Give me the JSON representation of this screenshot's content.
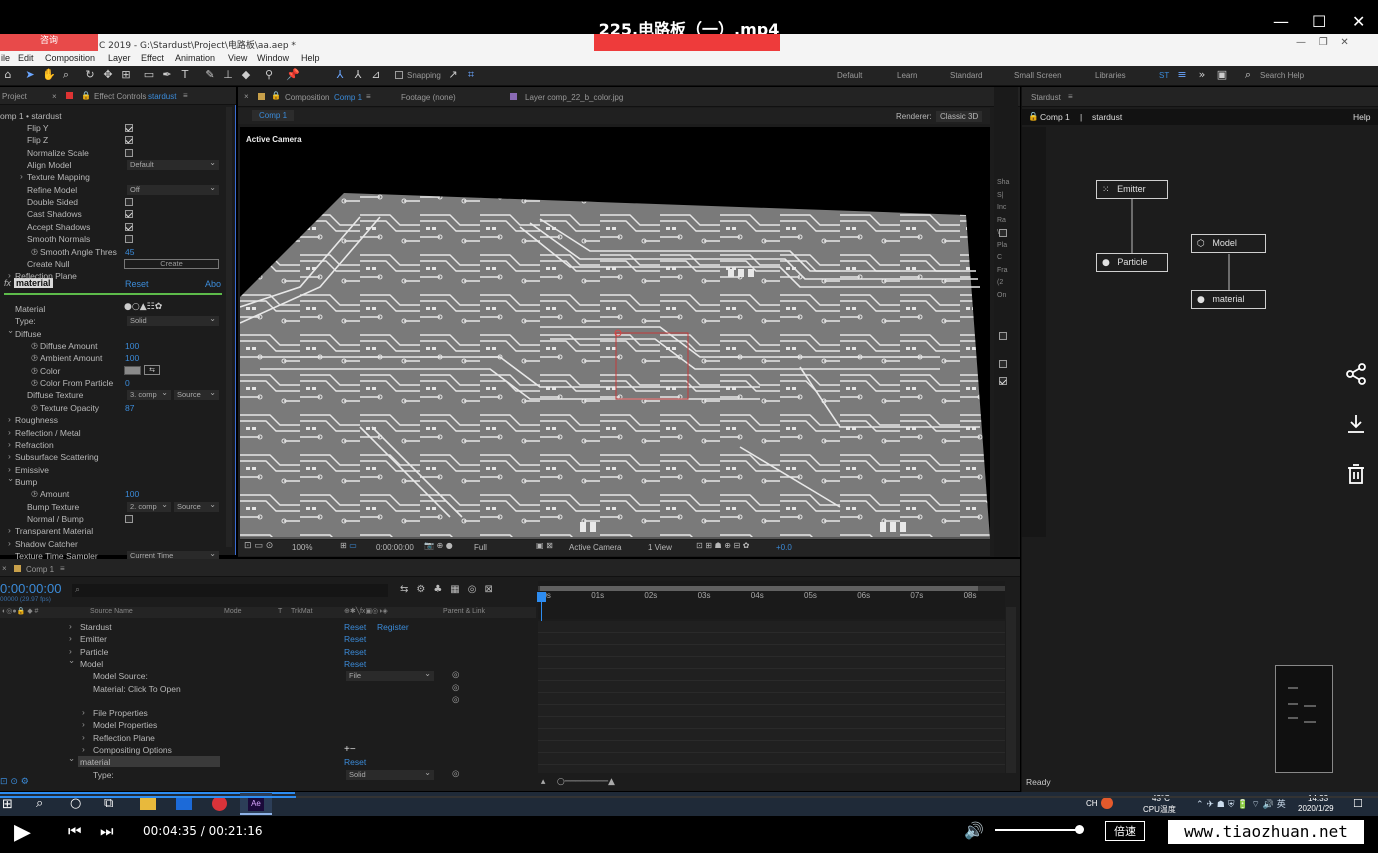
{
  "video_title": "225.电路板（一）.mp4",
  "window_buttons": {
    "minimize": "—",
    "maximize": "☐",
    "close": "✕"
  },
  "ask_button": "咨询",
  "ae_title": "C 2019 - G:\\Stardust\\Project\\电路板\\aa.aep *",
  "menu": [
    "ile",
    "Edit",
    "Composition",
    "Layer",
    "Effect",
    "Animation",
    "View",
    "Window",
    "Help"
  ],
  "toolbar": {
    "snapping": "Snapping"
  },
  "workspaces": [
    "Default",
    "Learn",
    "Standard",
    "Small Screen",
    "Libraries",
    "ST"
  ],
  "search_help": "Search Help",
  "project_tab": "Project",
  "effect_controls_tab": "Effect Controls",
  "effect_controls_layer": "stardust",
  "ec_breadcrumb": "omp 1 • stardust",
  "effect_rows": [
    {
      "label": "Flip Y",
      "indent": 27,
      "check": true
    },
    {
      "label": "Flip Z",
      "indent": 27,
      "check": true
    },
    {
      "label": "Normalize Scale",
      "indent": 27,
      "check": false
    },
    {
      "label": "Align Model",
      "indent": 27,
      "dropdown": "Default"
    },
    {
      "label": "Texture Mapping",
      "indent": 27,
      "arrow": true
    },
    {
      "label": "Refine Model",
      "indent": 27,
      "dropdown": "Off"
    },
    {
      "label": "Double Sided",
      "indent": 27,
      "check": false
    },
    {
      "label": "Cast Shadows",
      "indent": 27,
      "check": true
    },
    {
      "label": "Accept Shadows",
      "indent": 27,
      "check": true
    },
    {
      "label": "Smooth Normals",
      "indent": 27,
      "check": false
    },
    {
      "label": "Smooth Angle Thres",
      "indent": 40,
      "value": "45",
      "stopwatch": true,
      "arrow": true
    },
    {
      "label": "Create Null",
      "indent": 27,
      "button": "Create"
    },
    {
      "label": "Reflection Plane",
      "indent": 15,
      "arrow": true
    }
  ],
  "material_header": {
    "name": "material",
    "reset": "Reset",
    "about": "Abo"
  },
  "material_rows": [
    {
      "label": "Material",
      "indent": 15
    },
    {
      "label": "Type:",
      "indent": 15,
      "dropdown": "Solid"
    },
    {
      "label": "Diffuse",
      "indent": 15,
      "open": true
    },
    {
      "label": "Diffuse Amount",
      "indent": 40,
      "value": "100",
      "stopwatch": true,
      "arrow": true
    },
    {
      "label": "Ambient Amount",
      "indent": 40,
      "value": "100",
      "stopwatch": true,
      "arrow": true
    },
    {
      "label": "Color",
      "indent": 40,
      "stopwatch": true,
      "arrow": true,
      "swatch": true
    },
    {
      "label": "Color From Particle",
      "indent": 40,
      "value": "0",
      "stopwatch": true,
      "arrow": true
    },
    {
      "label": "Diffuse Texture",
      "indent": 27,
      "dropdown": "3. comp",
      "dropdown2": "Source"
    },
    {
      "label": "Texture Opacity",
      "indent": 40,
      "value": "87",
      "stopwatch": true,
      "arrow": true
    },
    {
      "label": "Roughness",
      "indent": 15,
      "arrow": true
    },
    {
      "label": "Reflection / Metal",
      "indent": 15,
      "arrow": true
    },
    {
      "label": "Refraction",
      "indent": 15,
      "arrow": true
    },
    {
      "label": "Subsurface Scattering",
      "indent": 15,
      "arrow": true
    },
    {
      "label": "Emissive",
      "indent": 15,
      "arrow": true
    },
    {
      "label": "Bump",
      "indent": 15,
      "open": true
    },
    {
      "label": "Amount",
      "indent": 40,
      "value": "100",
      "stopwatch": true,
      "arrow": true
    },
    {
      "label": "Bump Texture",
      "indent": 27,
      "dropdown": "2. comp",
      "dropdown2": "Source"
    },
    {
      "label": "Normal / Bump",
      "indent": 27,
      "check": false
    },
    {
      "label": "Transparent Material",
      "indent": 15,
      "arrow": true
    },
    {
      "label": "Shadow Catcher",
      "indent": 15,
      "arrow": true
    },
    {
      "label": "Texture Time Sampler",
      "indent": 15,
      "dropdown": "Current Time"
    }
  ],
  "comp_tabs": [
    "Composition",
    "Footage (none)",
    "Layer comp_22_b_color.jpg"
  ],
  "comp_tab_name": "Comp 1",
  "comp_subtab": "Comp 1",
  "renderer_label": "Renderer:",
  "renderer_value": "Classic 3D",
  "active_camera_label": "Active Camera",
  "viewer_footer": {
    "zoom": "100%",
    "timecode": "0:00:00:00",
    "resolution": "Full",
    "camera": "Active Camera",
    "views": "1 View",
    "exposure": "+0.0"
  },
  "side_strip": [
    "Sha",
    "S|",
    "Inc",
    "Ra",
    "W",
    "Pla",
    "C",
    "Fra",
    "(2",
    "On"
  ],
  "stardust_panel": {
    "title": "Stardust",
    "comp": "Comp 1",
    "layer": "stardust",
    "help": "Help",
    "nodes": [
      "Emitter",
      "Particle",
      "Model",
      "material"
    ],
    "status": "Ready"
  },
  "timeline": {
    "tab": "Comp 1",
    "timecode": "0:00:00:00",
    "fps": "00000 (29.97 fps)",
    "columns": [
      "Source Name",
      "Mode",
      "T",
      "TrkMat",
      "Parent & Link"
    ],
    "ruler": [
      "00s",
      "01s",
      "02s",
      "03s",
      "04s",
      "05s",
      "06s",
      "07s",
      "08s"
    ]
  },
  "timeline_rows": [
    {
      "label": "Stardust",
      "indent": 80,
      "arrow": true,
      "reset": "Reset",
      "extra": "Register"
    },
    {
      "label": "Emitter",
      "indent": 80,
      "arrow": true,
      "reset": "Reset"
    },
    {
      "label": "Particle",
      "indent": 80,
      "arrow": true,
      "reset": "Reset"
    },
    {
      "label": "Model",
      "indent": 80,
      "open": true,
      "reset": "Reset"
    },
    {
      "label": "Model Source:",
      "indent": 93,
      "dropdown": "File"
    },
    {
      "label": "Material: Click To Open",
      "indent": 93
    },
    {
      "label": "",
      "indent": 93
    },
    {
      "label": "File Properties",
      "indent": 93,
      "arrow": true
    },
    {
      "label": "Model Properties",
      "indent": 93,
      "arrow": true
    },
    {
      "label": "Reflection Plane",
      "indent": 93,
      "arrow": true
    },
    {
      "label": "Compositing Options",
      "indent": 93,
      "arrow": true,
      "plusminus": "+−"
    },
    {
      "label": "material",
      "indent": 80,
      "open": true,
      "reset": "Reset",
      "highlight": true
    },
    {
      "label": "Type:",
      "indent": 93,
      "dropdown": "Solid"
    }
  ],
  "taskbar": {
    "lang": "CH",
    "temp": "43°C",
    "cpu": "CPU温度",
    "time": "14:33",
    "date": "2020/1/29"
  },
  "player": {
    "current": "00:04:35",
    "total": "00:21:16",
    "separator": " / ",
    "speed": "倍速",
    "watermark": "www.tiaozhuan.net",
    "progress": 0.215
  },
  "colors": {
    "accent": "#3b8bd9",
    "red": "#ee3b3b",
    "timeline_blue": "#2d8cf0"
  }
}
